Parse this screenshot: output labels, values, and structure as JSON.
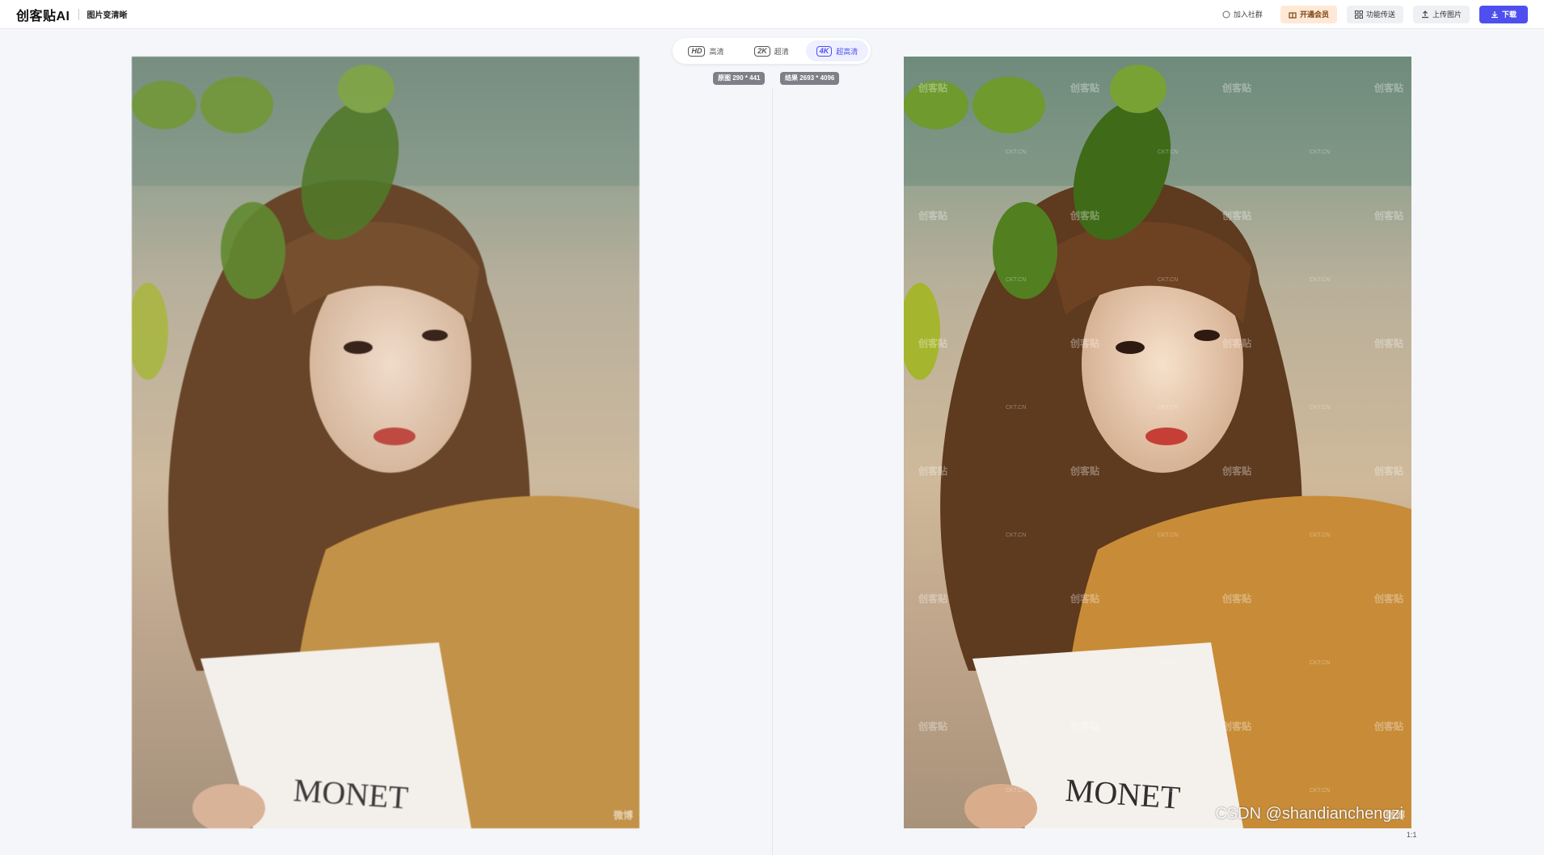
{
  "header": {
    "logo": "创客贴AI",
    "page_name": "图片变清晰",
    "join_community": "加入社群",
    "open_vip": "开通会员",
    "feature_nav": "功能传送",
    "upload_image": "上传图片",
    "download": "下载"
  },
  "resolution_tabs": [
    {
      "badge": "HD",
      "label": "高清"
    },
    {
      "badge": "2K",
      "label": "超清"
    },
    {
      "badge": "4K",
      "label": "超高清",
      "active": true
    }
  ],
  "dimensions": {
    "original": "原图 290 * 441",
    "result": "结果 2693 * 4096"
  },
  "photo": {
    "book_text": "MONET",
    "signature": "微博",
    "watermark_main": "创客贴",
    "watermark_small": "CKT.CN"
  },
  "zoom": {
    "value": "1:1"
  },
  "footer_watermark": "CSDN @shandianchengzi",
  "colors": {
    "accent": "#4f4ff0",
    "vip_bg": "#ffe8d6",
    "page_bg": "#f5f6fa"
  }
}
